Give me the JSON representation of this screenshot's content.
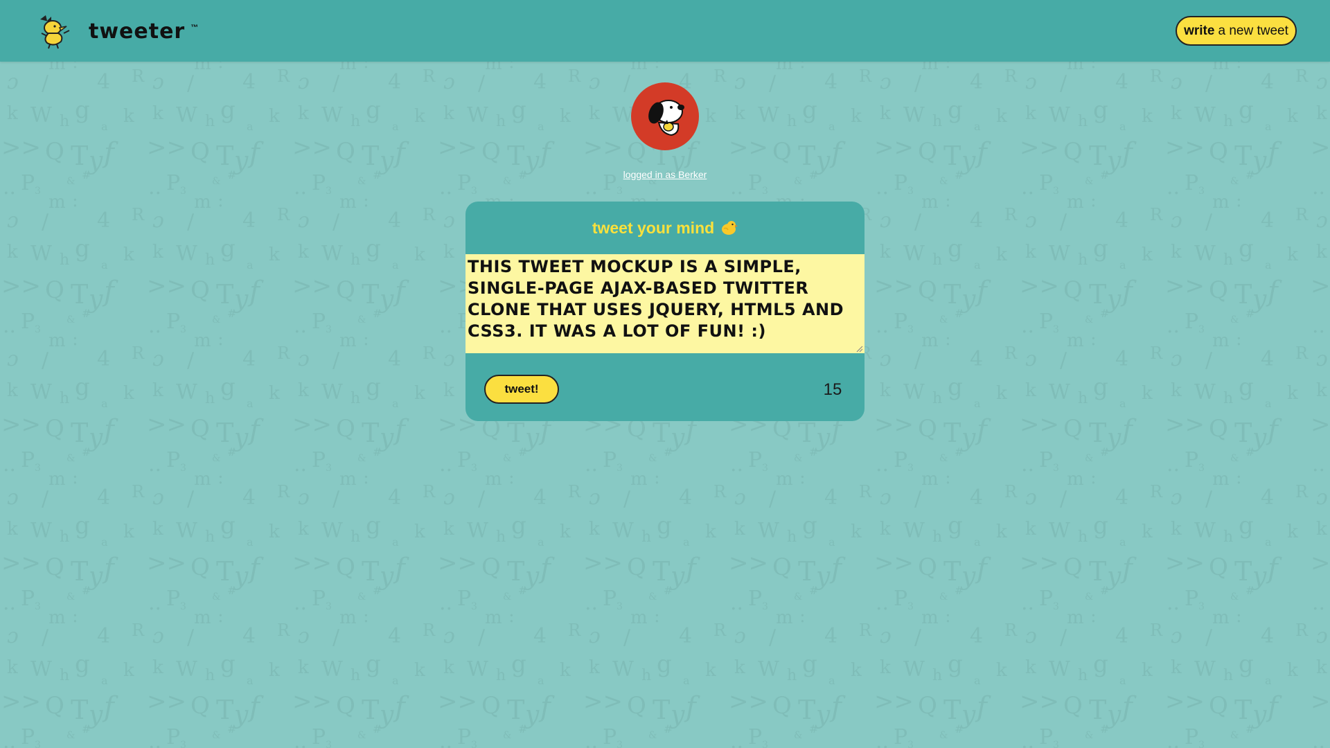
{
  "header": {
    "brand_name": "tweeter",
    "trademark": "™",
    "write_button_bold": "write",
    "write_button_rest": "a new tweet",
    "logo_icon": "woodstock-bird-icon"
  },
  "profile": {
    "avatar_icon": "snoopy-avatar-icon",
    "login_text": "logged in as Berker"
  },
  "compose": {
    "title": "tweet your mind",
    "title_icon": "chick-icon",
    "tweet_text": "This tweet mockup is a simple, single-page AJAX-based Twitter clone that uses jQuery, HTML5 and CSS3. It was a lot of fun! :)",
    "submit_label": "tweet!",
    "char_counter": "15"
  },
  "colors": {
    "page_background": "#88c9c4",
    "navbar": "#47aba6",
    "accent_yellow": "#fbdf40",
    "title_yellow": "#fbe13c",
    "textarea_background": "#fdf7a2",
    "avatar_red": "#d33b27"
  }
}
